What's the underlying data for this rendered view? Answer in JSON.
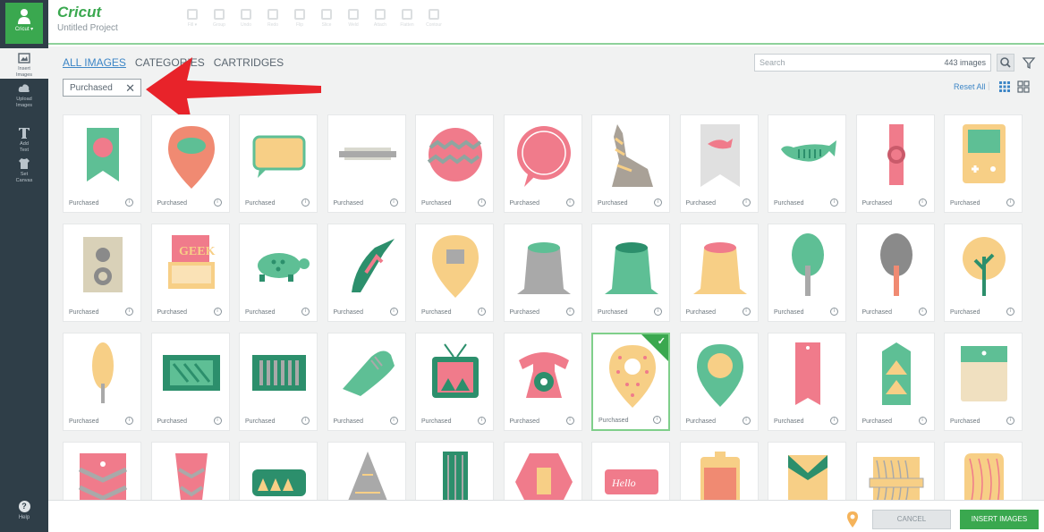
{
  "sidebar": {
    "account_label": "Cricut ▾",
    "items": [
      {
        "label": "Insert\nImages",
        "icon": "image-icon"
      },
      {
        "label": "Upload\nImages",
        "icon": "cloud-upload-icon"
      },
      {
        "label": "Add\nText",
        "icon": "text-icon"
      },
      {
        "label": "Set\nCanvas",
        "icon": "shirt-icon"
      }
    ],
    "help_label": "Help"
  },
  "header": {
    "logo": "Cricut",
    "project_name": "Untitled Project",
    "toolbar": [
      "Fill ▾",
      "Group",
      "Undo",
      "Redo",
      "Flip",
      "Slice",
      "Weld",
      "Attach",
      "Flatten",
      "Contour"
    ]
  },
  "panel": {
    "tabs": [
      {
        "label": "ALL IMAGES",
        "active": true
      },
      {
        "label": "CATEGORIES",
        "active": false
      },
      {
        "label": "CARTRIDGES",
        "active": false
      }
    ],
    "search_placeholder": "Search",
    "image_count": "443 images",
    "filter_chip": "Purchased",
    "reset_all": "Reset All"
  },
  "images": {
    "card_label": "Purchased",
    "info_glyph": "i",
    "check_glyph": "✓",
    "items": [
      {
        "shape": "banner",
        "c1": "#5ebf95",
        "c2": "#f07b8b"
      },
      {
        "shape": "pin-speech",
        "c1": "#f08a72",
        "c2": "#5ebf95"
      },
      {
        "shape": "speech-rect",
        "c1": "#f7cf86",
        "c2": "#5ebf95"
      },
      {
        "shape": "ribbon",
        "c1": "#d9d9cf",
        "c2": "#a9a9a9"
      },
      {
        "shape": "circle-zig",
        "c1": "#f07b8b",
        "c2": "#8fa5a0"
      },
      {
        "shape": "speech-scallop",
        "c1": "#f07b8b",
        "c2": "#ffffff"
      },
      {
        "shape": "wolf",
        "c1": "#a9a197",
        "c2": "#f7cf86"
      },
      {
        "shape": "pennant-whale",
        "c1": "#e0e0e0",
        "c2": "#f07b8b"
      },
      {
        "shape": "whale",
        "c1": "#5ebf95",
        "c2": "#2c8f6c"
      },
      {
        "shape": "watch",
        "c1": "#f07b8b",
        "c2": "#c95a6a"
      },
      {
        "shape": "gameboy",
        "c1": "#f7cf86",
        "c2": "#5ebf95"
      },
      {
        "shape": "camera",
        "c1": "#d9d1b8",
        "c2": "#8a8a8a"
      },
      {
        "shape": "typewriter",
        "c1": "#f07b8b",
        "c2": "#f7cf86"
      },
      {
        "shape": "turtle",
        "c1": "#5ebf95",
        "c2": "#2c8f6c"
      },
      {
        "shape": "toucan",
        "c1": "#2c8f6c",
        "c2": "#f07b8b"
      },
      {
        "shape": "pin-face",
        "c1": "#f7cf86",
        "c2": "#a9a9a9"
      },
      {
        "shape": "stump",
        "c1": "#a9a9a9",
        "c2": "#5ebf95"
      },
      {
        "shape": "stump",
        "c1": "#5ebf95",
        "c2": "#2c8f6c"
      },
      {
        "shape": "stump",
        "c1": "#f7cf86",
        "c2": "#f07b8b"
      },
      {
        "shape": "tree-oval",
        "c1": "#5ebf95",
        "c2": "#a9a9a9"
      },
      {
        "shape": "tree-oval",
        "c1": "#8a8a8a",
        "c2": "#f08a72"
      },
      {
        "shape": "tree-round",
        "c1": "#f7cf86",
        "c2": "#2c8f6c"
      },
      {
        "shape": "tree-tall",
        "c1": "#f7cf86",
        "c2": "#a9a9a9"
      },
      {
        "shape": "ticket",
        "c1": "#2c8f6c",
        "c2": "#5ebf95"
      },
      {
        "shape": "ticket-bars",
        "c1": "#2c8f6c",
        "c2": "#a9a9a9"
      },
      {
        "shape": "shoe",
        "c1": "#5ebf95",
        "c2": "#a9a9a9"
      },
      {
        "shape": "tv",
        "c1": "#2c8f6c",
        "c2": "#f07b8b"
      },
      {
        "shape": "phone",
        "c1": "#f07b8b",
        "c2": "#2c8f6c"
      },
      {
        "shape": "pin-dots",
        "c1": "#f7cf86",
        "c2": "#f07b8b",
        "selected": true
      },
      {
        "shape": "pin",
        "c1": "#5ebf95",
        "c2": "#f7cf86"
      },
      {
        "shape": "tag-tall",
        "c1": "#f07b8b",
        "c2": "#5ebf95"
      },
      {
        "shape": "tag-tri",
        "c1": "#5ebf95",
        "c2": "#f7cf86"
      },
      {
        "shape": "tag-wide",
        "c1": "#f0e0c0",
        "c2": "#5ebf95"
      },
      {
        "shape": "tag-chevron",
        "c1": "#f07b8b",
        "c2": "#a9a9a9"
      },
      {
        "shape": "pennant-v",
        "c1": "#f07b8b",
        "c2": "#a9a9a9"
      },
      {
        "shape": "ticket-tri",
        "c1": "#2c8f6c",
        "c2": "#f7cf86"
      },
      {
        "shape": "triangle",
        "c1": "#a9a9a9",
        "c2": "#f7cf86"
      },
      {
        "shape": "stripe-bar",
        "c1": "#2c8f6c",
        "c2": "#a9a9a9"
      },
      {
        "shape": "hexagon",
        "c1": "#f07b8b",
        "c2": "#f7cf86"
      },
      {
        "shape": "label-script",
        "c1": "#f07b8b",
        "c2": "#ffffff"
      },
      {
        "shape": "tag-square",
        "c1": "#f08a72",
        "c2": "#f7cf86"
      },
      {
        "shape": "tag-bow",
        "c1": "#f7cf86",
        "c2": "#2c8f6c"
      },
      {
        "shape": "box-woodgrain",
        "c1": "#f7cf86",
        "c2": "#a9a9a9"
      },
      {
        "shape": "tag-woodgrain",
        "c1": "#f7cf86",
        "c2": "#f07b8b"
      }
    ]
  },
  "footer": {
    "cancel": "CANCEL",
    "insert": "INSERT IMAGES"
  }
}
